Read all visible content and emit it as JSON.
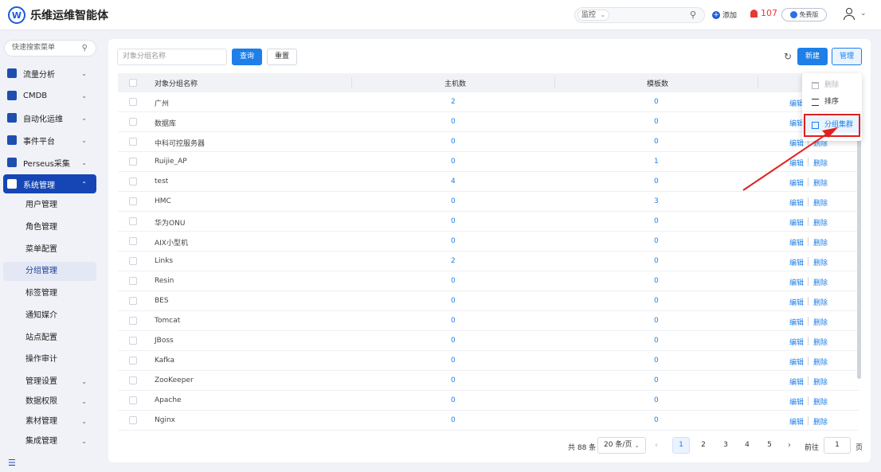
{
  "header": {
    "logo_letter": "W",
    "title": "乐维运维智能体",
    "search_scope": "监控",
    "add_label": "添加",
    "alert_count": "107",
    "plan_label": "免费版"
  },
  "sidebar": {
    "search_placeholder": "快速搜索菜单",
    "menus": [
      {
        "label": "流量分析"
      },
      {
        "label": "CMDB"
      },
      {
        "label": "自动化运维"
      },
      {
        "label": "事件平台"
      },
      {
        "label": "Perseus采集"
      },
      {
        "label": "系统管理"
      }
    ],
    "sub_items": [
      {
        "label": "用户管理"
      },
      {
        "label": "角色管理"
      },
      {
        "label": "菜单配置"
      },
      {
        "label": "分组管理"
      },
      {
        "label": "标签管理"
      },
      {
        "label": "通知媒介"
      },
      {
        "label": "站点配置"
      },
      {
        "label": "操作审计"
      },
      {
        "label": "管理设置"
      },
      {
        "label": "数据权限"
      },
      {
        "label": "素材管理"
      },
      {
        "label": "集成管理"
      }
    ]
  },
  "toolbar": {
    "name_placeholder": "对象分组名称",
    "query_label": "查询",
    "reset_label": "重置",
    "new_label": "新建",
    "manage_label": "管理"
  },
  "table": {
    "columns": {
      "name": "对象分组名称",
      "hosts": "主机数",
      "templates": "模板数"
    },
    "edit_label": "编辑",
    "delete_label": "删除",
    "rows": [
      {
        "name": "广州",
        "hosts": "2",
        "templates": "0"
      },
      {
        "name": "数据库",
        "hosts": "0",
        "templates": "0"
      },
      {
        "name": "中科可控服务器",
        "hosts": "0",
        "templates": "0"
      },
      {
        "name": "Ruijie_AP",
        "hosts": "0",
        "templates": "1"
      },
      {
        "name": "test",
        "hosts": "4",
        "templates": "0"
      },
      {
        "name": "HMC",
        "hosts": "0",
        "templates": "3"
      },
      {
        "name": "华为ONU",
        "hosts": "0",
        "templates": "0"
      },
      {
        "name": "AIX小型机",
        "hosts": "0",
        "templates": "0"
      },
      {
        "name": "Links",
        "hosts": "2",
        "templates": "0"
      },
      {
        "name": "Resin",
        "hosts": "0",
        "templates": "0"
      },
      {
        "name": "BES",
        "hosts": "0",
        "templates": "0"
      },
      {
        "name": "Tomcat",
        "hosts": "0",
        "templates": "0"
      },
      {
        "name": "JBoss",
        "hosts": "0",
        "templates": "0"
      },
      {
        "name": "Kafka",
        "hosts": "0",
        "templates": "0"
      },
      {
        "name": "ZooKeeper",
        "hosts": "0",
        "templates": "0"
      },
      {
        "name": "Apache",
        "hosts": "0",
        "templates": "0"
      },
      {
        "name": "Nginx",
        "hosts": "0",
        "templates": "0"
      }
    ]
  },
  "dropdown": {
    "delete_label": "删除",
    "sort_label": "排序",
    "cluster_label": "分组集群"
  },
  "pagination": {
    "total_text": "共 88 条",
    "page_size": "20 条/页",
    "pages": [
      "1",
      "2",
      "3",
      "4",
      "5"
    ],
    "current_page": "1",
    "goto_label": "前往",
    "goto_value": "1",
    "page_unit": "页"
  },
  "colors": {
    "primary": "#1e7fe8",
    "sidebar_active": "#1646b5",
    "alert": "#e53935",
    "highlight_box": "#e02020"
  }
}
